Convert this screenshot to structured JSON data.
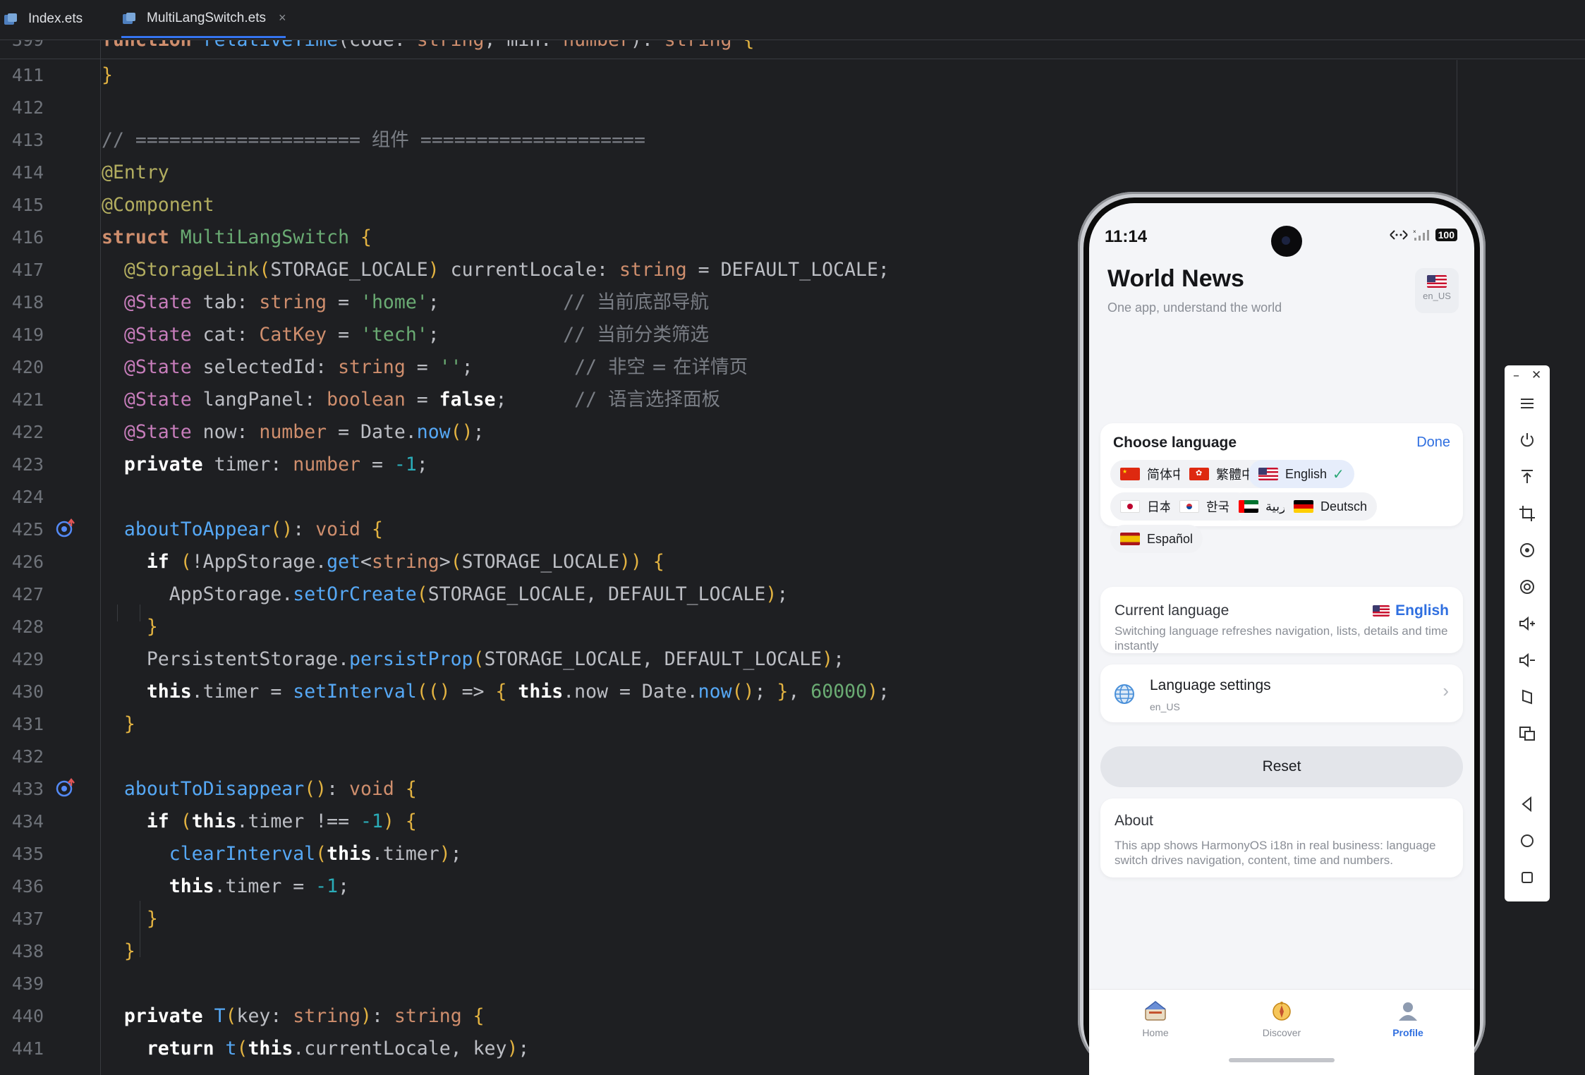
{
  "tabs": [
    {
      "label": "Index.ets",
      "active": false
    },
    {
      "label": "MultiLangSwitch.ets",
      "active": true,
      "close": "×"
    }
  ],
  "editor": {
    "sticky_number": "399",
    "sticky_code": "function relativeTime(code: string, min: number): string {",
    "line_numbers": [
      "411",
      "412",
      "413",
      "414",
      "415",
      "416",
      "417",
      "418",
      "419",
      "420",
      "421",
      "422",
      "423",
      "424",
      "425",
      "426",
      "427",
      "428",
      "429",
      "430",
      "431",
      "432",
      "433",
      "434",
      "435",
      "436",
      "437",
      "438",
      "439",
      "440",
      "441"
    ],
    "gutter_icons": [
      {
        "line": "425",
        "icon": "override-method-icon"
      },
      {
        "line": "433",
        "icon": "override-method-icon"
      }
    ]
  },
  "app": {
    "status": {
      "time": "11:14",
      "battery": "100"
    },
    "header": {
      "title": "World News",
      "subtitle": "One app, understand the world",
      "locale": "en_US"
    },
    "language_panel": {
      "title": "Choose language",
      "done": "Done",
      "languages": [
        {
          "label": "简体中文",
          "flag": "cn",
          "selected": false
        },
        {
          "label": "繁體中文",
          "flag": "hk",
          "selected": false
        },
        {
          "label": "English",
          "flag": "us",
          "selected": true,
          "check": "✓"
        },
        {
          "label": "日本語",
          "flag": "jp",
          "selected": false
        },
        {
          "label": "한국어",
          "flag": "kr",
          "selected": false
        },
        {
          "label": "العربية",
          "flag": "ae",
          "selected": false
        },
        {
          "label": "Deutsch",
          "flag": "de",
          "selected": false
        },
        {
          "label": "Español",
          "flag": "es",
          "selected": false
        }
      ]
    },
    "current_language": {
      "label": "Current language",
      "value": "English",
      "description": "Switching language refreshes navigation, lists, details and time instantly"
    },
    "language_settings": {
      "label": "Language settings",
      "sub": "en_US",
      "chevron": "›"
    },
    "reset": "Reset",
    "about": {
      "title": "About",
      "text": "This app shows HarmonyOS i18n in real business: language switch drives navigation, content, time and numbers."
    },
    "nav": [
      {
        "label": "Home",
        "icon": "home-icon",
        "active": false
      },
      {
        "label": "Discover",
        "icon": "compass-icon",
        "active": false
      },
      {
        "label": "Profile",
        "icon": "profile-icon",
        "active": true
      }
    ]
  },
  "emulator_toolbar": {
    "buttons": [
      "minimize-icon",
      "close-icon",
      "menu-icon",
      "power-icon",
      "pin-top-icon",
      "crop-icon",
      "rotate-icon",
      "screenshot-icon",
      "volume-up-icon",
      "volume-down-icon",
      "fold-icon",
      "multi-screen-icon",
      "back-icon",
      "home-circle-icon",
      "recent-apps-icon"
    ],
    "minimize": "–",
    "close": "✕"
  },
  "colors": {
    "accent": "#2f6fe0",
    "editor_bg": "#1e1f22",
    "keyword": "#cf8e6d",
    "string": "#6aab73",
    "number": "#2aacb8",
    "function": "#56a8f5"
  }
}
